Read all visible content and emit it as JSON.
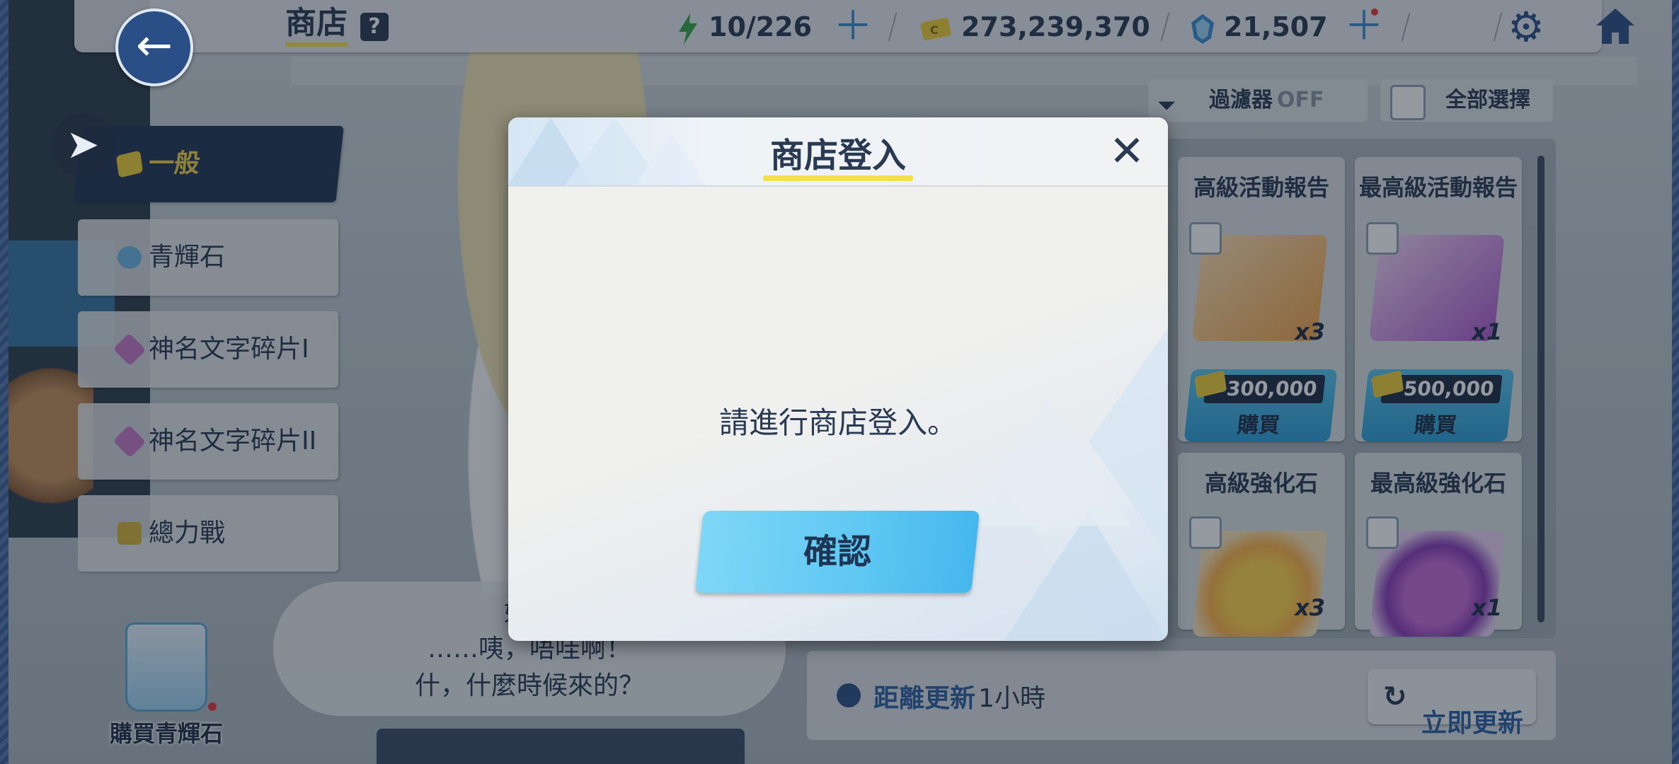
{
  "header": {
    "title": "商店",
    "help_icon": "?",
    "ap": "10/226",
    "credits": "273,239,370",
    "pyroxene": "21,507"
  },
  "filter": {
    "label": "過濾器",
    "state": "OFF"
  },
  "select_all": {
    "label": "全部選擇"
  },
  "categories": [
    {
      "label": "一般",
      "icon": "credit-card-icon"
    },
    {
      "label": "青輝石",
      "icon": "gem-icon"
    },
    {
      "label": "神名文字碎片I",
      "icon": "shard-icon"
    },
    {
      "label": "神名文字碎片II",
      "icon": "shard-icon"
    },
    {
      "label": "總力戰",
      "icon": "raid-icon"
    }
  ],
  "buy_gems": {
    "label": "購買青輝石"
  },
  "dialogue": {
    "lines": [
      "好閒",
      "……咦，唔哇啊！",
      "什，什麼時候來的？"
    ]
  },
  "items": [
    {
      "name": "高級活動報告",
      "qty": "x3",
      "price": "300,000",
      "buy": "購買"
    },
    {
      "name": "最高級活動報告",
      "qty": "x1",
      "price": "500,000",
      "buy": "購買"
    },
    {
      "name": "高級強化石",
      "qty": "x3"
    },
    {
      "name": "最高級強化石",
      "qty": "x1"
    }
  ],
  "refresh": {
    "label": "距離更新",
    "value": "1小時",
    "button": "立即更新"
  },
  "modal": {
    "title": "商店登入",
    "message": "請進行商店登入。",
    "confirm": "確認"
  },
  "colors": {
    "accent_yellow": "#f3e04a",
    "navy": "#2a3a52",
    "button_blue": "#5ec7f2"
  }
}
